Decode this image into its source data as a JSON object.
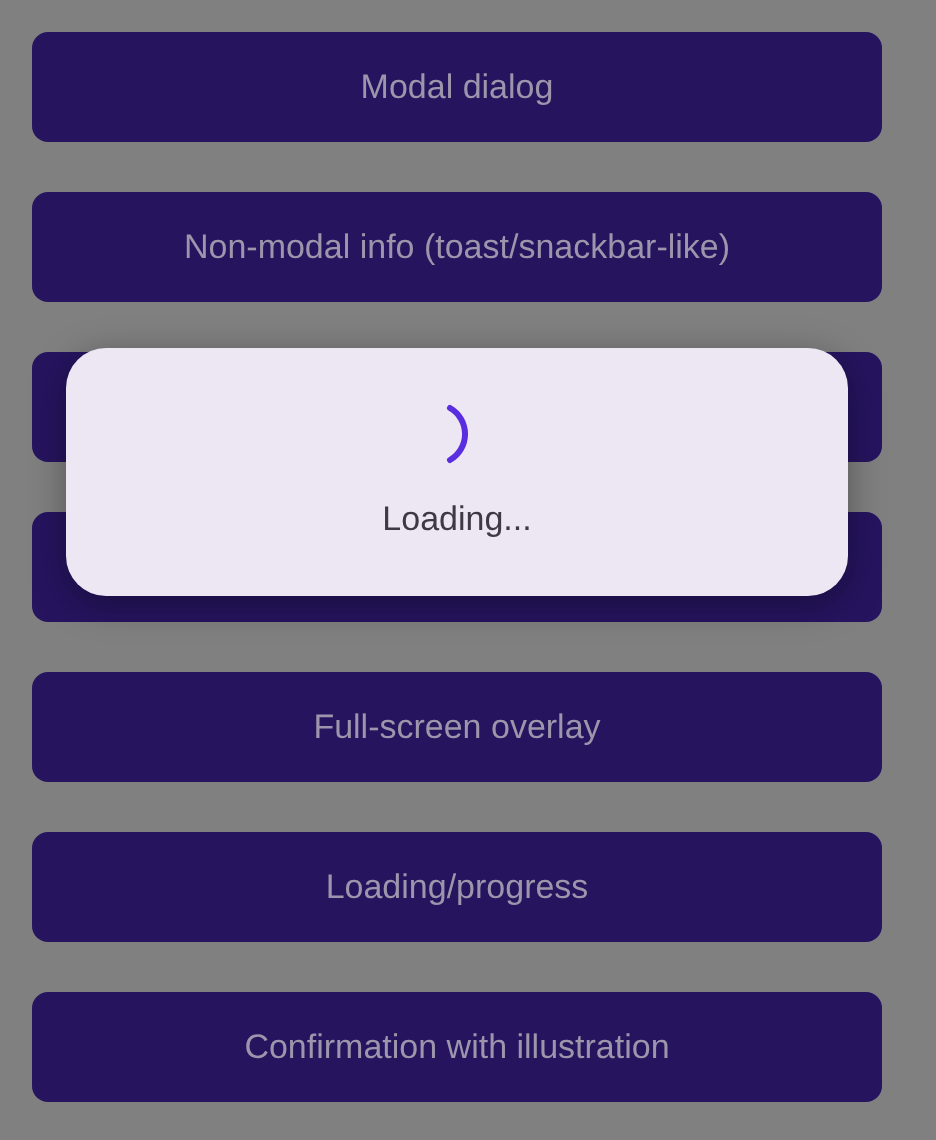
{
  "buttons": [
    {
      "kind": "button",
      "label": "Modal dialog"
    },
    {
      "kind": "button",
      "label": "Non-modal info (toast/snackbar-like)"
    },
    {
      "kind": "covered"
    },
    {
      "kind": "covered"
    },
    {
      "kind": "button",
      "label": "Full-screen overlay"
    },
    {
      "kind": "button",
      "label": "Loading/progress"
    },
    {
      "kind": "button",
      "label": "Confirmation with illustration"
    }
  ],
  "loading_dialog": {
    "message": "Loading..."
  }
}
